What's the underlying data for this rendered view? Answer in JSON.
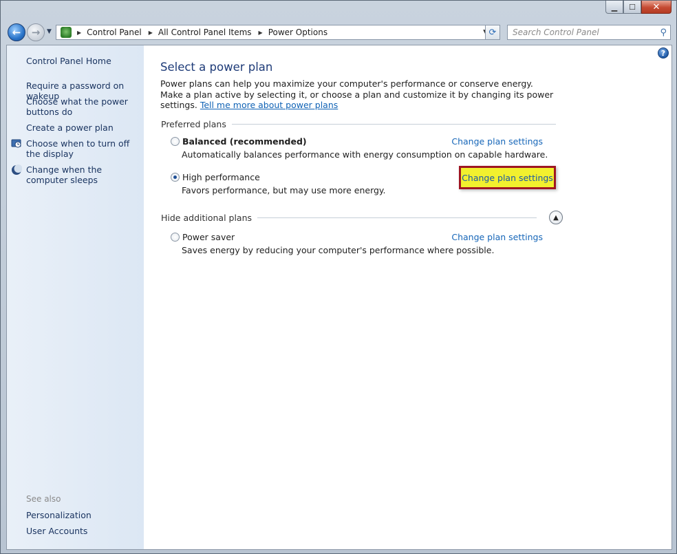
{
  "window": {
    "min_label": "▁",
    "max_label": "☐",
    "close_label": "✕"
  },
  "address_bar": {
    "crumbs": [
      "Control Panel",
      "All Control Panel Items",
      "Power Options"
    ],
    "refresh_label": "⟳"
  },
  "search": {
    "placeholder": "Search Control Panel"
  },
  "sidebar": {
    "home": "Control Panel Home",
    "items": [
      "Require a password on wakeup",
      "Choose what the power buttons do",
      "Create a power plan",
      "Choose when to turn off the display",
      "Change when the computer sleeps"
    ],
    "see_also_title": "See also",
    "see_also": [
      "Personalization",
      "User Accounts"
    ]
  },
  "main": {
    "title": "Select a power plan",
    "intro": "Power plans can help you maximize your computer's performance or conserve energy. Make a plan active by selecting it, or choose a plan and customize it by changing its power settings.",
    "intro_link": "Tell me more about power plans",
    "preferred_title": "Preferred plans",
    "hide_title": "Hide additional plans",
    "change_link": "Change plan settings",
    "plans": [
      {
        "name": "Balanced (recommended)",
        "desc": "Automatically balances performance with energy consumption on capable hardware.",
        "selected": false
      },
      {
        "name": "High performance",
        "desc": "Favors performance, but may use more energy.",
        "selected": true
      },
      {
        "name": "Power saver",
        "desc": "Saves energy by reducing your computer's performance where possible.",
        "selected": false
      }
    ]
  },
  "colors": {
    "highlight_fill": "#f2f02e",
    "highlight_border": "#9e1622",
    "link": "#1666b8",
    "title": "#1e3b78"
  }
}
